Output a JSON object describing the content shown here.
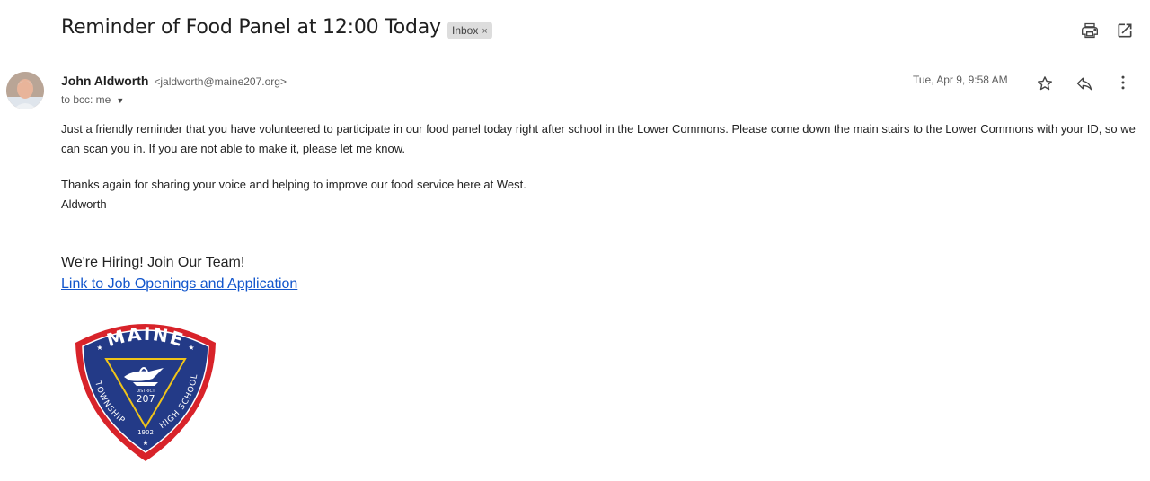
{
  "email": {
    "subject": "Reminder of Food Panel at 12:00 Today",
    "label": "Inbox",
    "label_remove": "×",
    "sender_name": "John Aldworth",
    "sender_email": "<jaldworth@maine207.org>",
    "to_line": "to bcc: me",
    "date": "Tue, Apr 9, 9:58 AM",
    "body_paragraph_1": "Just a friendly reminder that you have volunteered to participate in our food panel today right after school in the Lower Commons.  Please come down the main stairs to the Lower Commons with your ID, so we can scan you in.  If you are not able to make it, please let me know.",
    "body_paragraph_2": "Thanks again for sharing your voice and helping to improve our food service here at West.",
    "signature": "Aldworth",
    "hiring_text": "We're Hiring! Join Our Team!",
    "job_link": "Link to Job Openings and Application"
  },
  "logo": {
    "top": "MAINE",
    "left_arc": "TOWNSHIP",
    "right_arc": "HIGH SCHOOL",
    "district": "DISTRICT",
    "number": "207",
    "year": "1902"
  },
  "icons": {
    "print": "print-icon",
    "open_new": "open-in-new-window-icon",
    "star": "star-icon",
    "reply": "reply-icon",
    "more": "more-vert-icon"
  },
  "colors": {
    "link": "#1155cc",
    "logo_blue": "#233a87",
    "logo_red": "#d8232a",
    "logo_gold": "#f0c419"
  }
}
